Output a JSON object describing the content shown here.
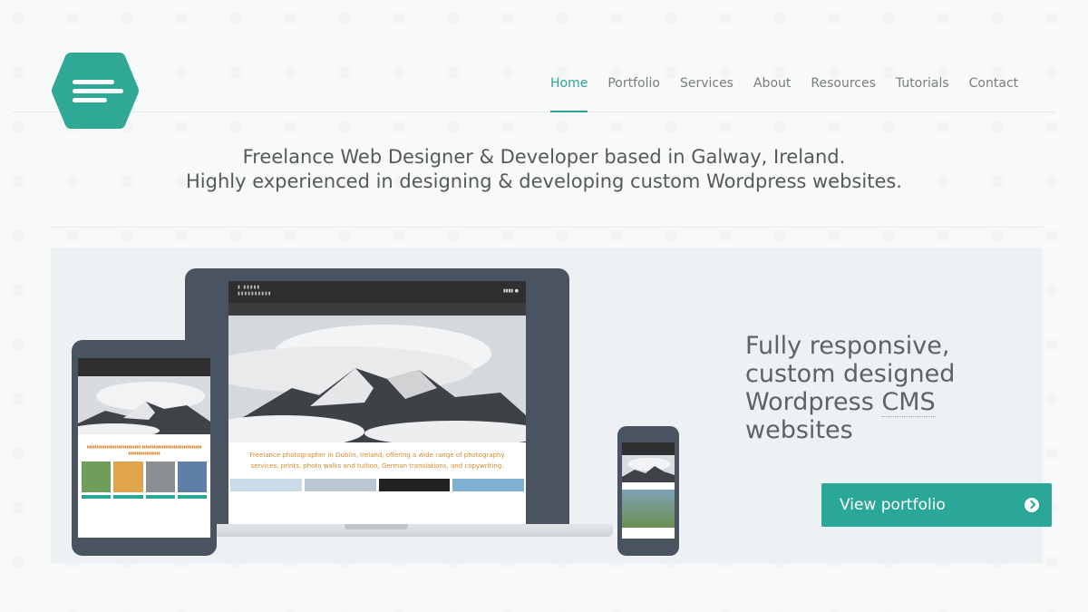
{
  "logo": {
    "icon": "menu-lines-icon",
    "color": "#2fa896"
  },
  "nav": {
    "items": [
      {
        "label": "Home",
        "active": true
      },
      {
        "label": "Portfolio",
        "active": false
      },
      {
        "label": "Services",
        "active": false
      },
      {
        "label": "About",
        "active": false
      },
      {
        "label": "Resources",
        "active": false
      },
      {
        "label": "Tutorials",
        "active": false
      },
      {
        "label": "Contact",
        "active": false
      }
    ]
  },
  "tagline": {
    "line1": "Freelance Web Designer & Developer based in Galway, Ireland.",
    "line2": "Highly experienced in designing & developing custom Wordpress websites."
  },
  "hero": {
    "heading_line1": "Fully responsive,",
    "heading_line2": "custom designed",
    "heading_line3_pre": "Wordpress ",
    "heading_line3_abbr": "CMS",
    "heading_line4": "websites",
    "cta_label": "View portfolio",
    "cta_icon": "chevron-right-circle-icon",
    "accent": "#2aa796"
  },
  "mockup": {
    "laptop_text": "Freelance photographer in Dublin, Ireland, offering a wide range of photography services, prints, photo walks and tuition, German translations, and copywriting."
  }
}
